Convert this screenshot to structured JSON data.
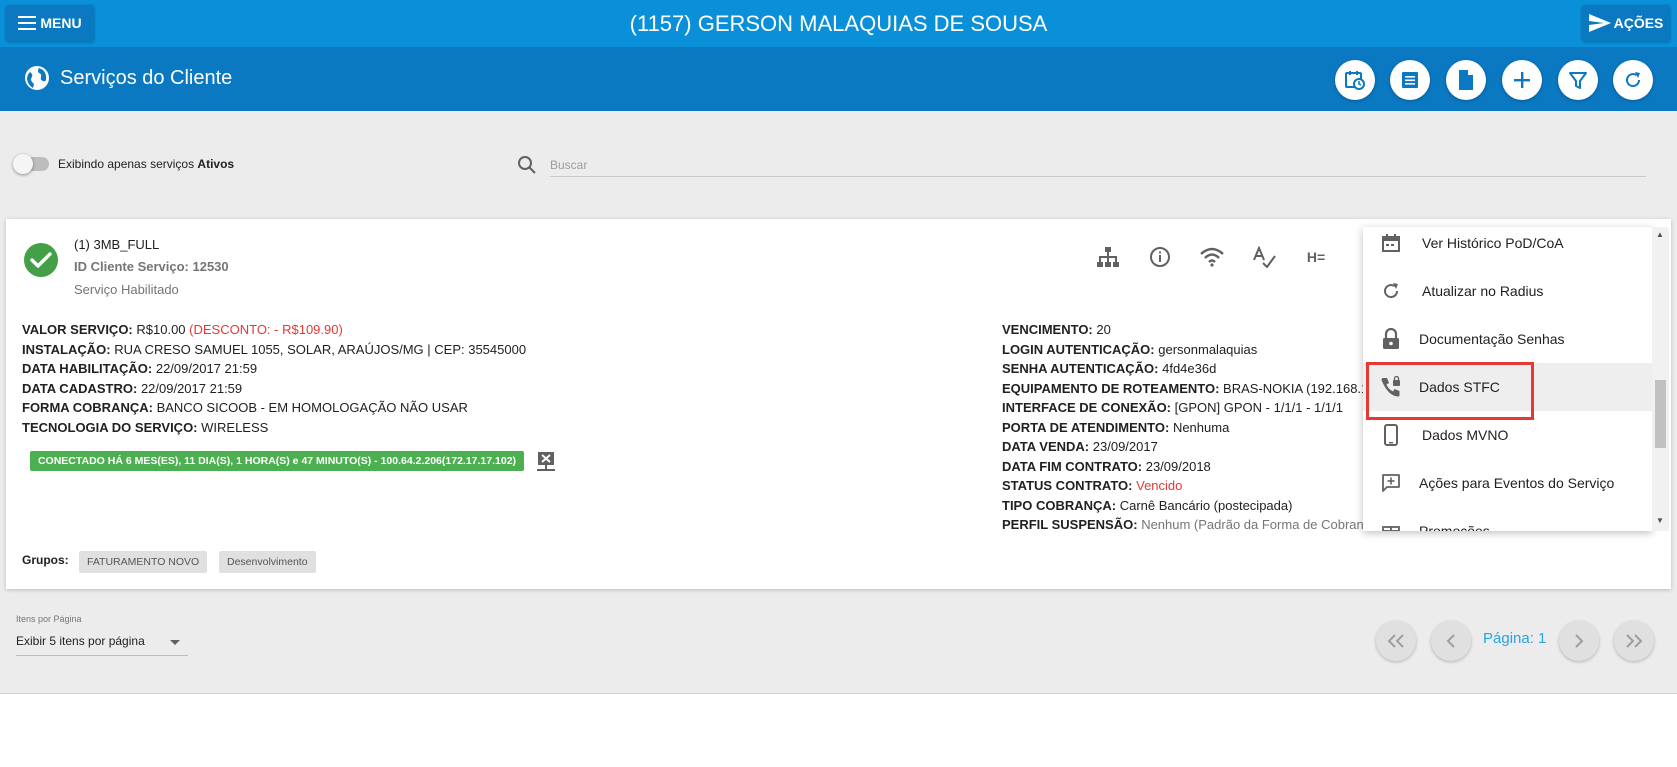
{
  "topbar": {
    "menu_label": "MENU",
    "title": "(1157) GERSON MALAQUIAS DE SOUSA",
    "acoes_label": "AÇÕES"
  },
  "subbar": {
    "title": "Serviços do Cliente",
    "actions": [
      "history-clock-icon",
      "list-icon",
      "document-icon",
      "add-icon",
      "filter-icon",
      "refresh-icon"
    ]
  },
  "filter": {
    "toggle_text": "Exibindo apenas serviços ",
    "toggle_bold": "Ativos",
    "search_placeholder": "Buscar"
  },
  "service": {
    "name": "(1) 3MB_FULL",
    "id_line": "ID Cliente Serviço: 12530",
    "status": "Serviço Habilitado",
    "left": [
      {
        "label": "VALOR SERVIÇO:",
        "value": "R$10.00",
        "extra": "(DESCONTO: - R$109.90)"
      },
      {
        "label": "INSTALAÇÃO:",
        "value": "RUA CRESO SAMUEL 1055, SOLAR, ARAÚJOS/MG | CEP: 35545000"
      },
      {
        "label": "DATA HABILITAÇÃO:",
        "value": "22/09/2017 21:59"
      },
      {
        "label": "DATA CADASTRO:",
        "value": "22/09/2017 21:59"
      },
      {
        "label": "FORMA COBRANÇA:",
        "value": "BANCO SICOOB - EM HOMOLOGAÇÃO NÃO USAR"
      },
      {
        "label": "TECNOLOGIA DO SERVIÇO:",
        "value": "WIRELESS"
      }
    ],
    "right": [
      {
        "label": "VENCIMENTO:",
        "value": "20"
      },
      {
        "label": "LOGIN AUTENTICAÇÃO:",
        "value": "gersonmalaquias"
      },
      {
        "label": "SENHA AUTENTICAÇÃO:",
        "value": "4fd4e36d"
      },
      {
        "label": "EQUIPAMENTO DE ROTEAMENTO:",
        "value": "BRAS-NOKIA (192.168.1"
      },
      {
        "label": "INTERFACE DE CONEXÃO:",
        "value": "[GPON] GPON - 1/1/1 - 1/1/1"
      },
      {
        "label": "PORTA DE ATENDIMENTO:",
        "value": "Nenhuma"
      },
      {
        "label": "DATA VENDA:",
        "value": "23/09/2017"
      },
      {
        "label": "DATA FIM CONTRATO:",
        "value": "23/09/2018"
      },
      {
        "label": "STATUS CONTRATO:",
        "value": "Vencido"
      },
      {
        "label": "TIPO COBRANÇA:",
        "value": "Carnê Bancário (postecipada)"
      },
      {
        "label": "PERFIL SUSPENSÃO:",
        "value": "Nenhum (Padrão da Forma de Cobran"
      }
    ],
    "connection": "CONECTADO HÁ 6 MES(ES), 11 DIA(S), 1 HORA(S) e 47 MINUTO(S) - 100.64.2.206(172.17.17.102)",
    "grupos_label": "Grupos:",
    "grupos": [
      "FATURAMENTO NOVO",
      "Desenvolvimento"
    ],
    "card_icons": [
      "sitemap-icon",
      "info-icon",
      "wifi-icon",
      "spellcheck-icon",
      "heading-icon"
    ],
    "heading_glyph": "H="
  },
  "dropdown": {
    "items": [
      {
        "label": "Ver Histórico PoD/CoA",
        "icon": "calendar-icon"
      },
      {
        "label": "Atualizar no Radius",
        "icon": "refresh-icon"
      },
      {
        "label": "Documentação Senhas",
        "icon": "lock-icon"
      },
      {
        "label": "Dados STFC",
        "icon": "phone-lock-icon"
      },
      {
        "label": "Dados MVNO",
        "icon": "mobile-icon"
      },
      {
        "label": "Ações para Eventos do Serviço",
        "icon": "comment-add-icon"
      },
      {
        "label": "Promoções",
        "icon": "gift-icon"
      }
    ]
  },
  "footer": {
    "ipp_label": "Itens por Página",
    "ipp_value": "Exibir 5 itens por página",
    "page_label": "Página: 1"
  },
  "colors": {
    "topbar": "#0a90d8",
    "subbar": "#0b78c2",
    "success": "#43a047",
    "danger": "#e53935",
    "link": "#29a3e6"
  }
}
